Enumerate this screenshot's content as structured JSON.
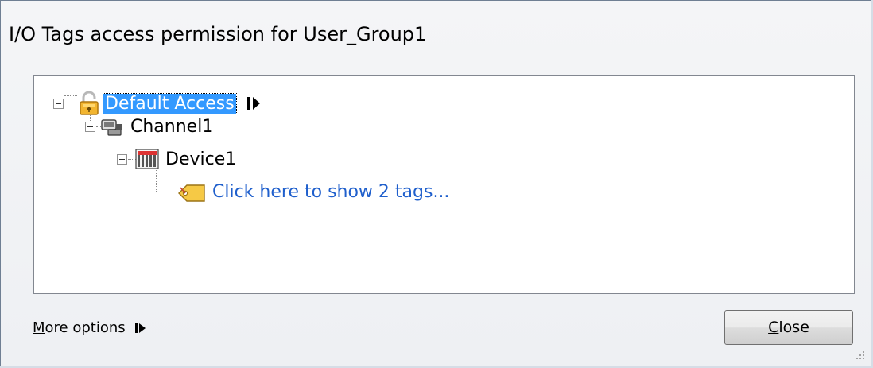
{
  "dialog": {
    "title": "I/O Tags access permission for User_Group1"
  },
  "tree": {
    "root_label": "Default Access",
    "channel_label": "Channel1",
    "device_label": "Device1",
    "tags_link": "Click here to show 2 tags..."
  },
  "icons": {
    "root": "padlock-icon",
    "channel": "network-channel-icon",
    "device": "device-icon",
    "tag": "tag-icon",
    "more": "play-arrow-icon"
  },
  "footer": {
    "more_options_first": "M",
    "more_options_rest": "ore options",
    "close_first": "C",
    "close_rest": "lose"
  },
  "colors": {
    "selection": "#3399ff",
    "link": "#1f5fcc"
  }
}
